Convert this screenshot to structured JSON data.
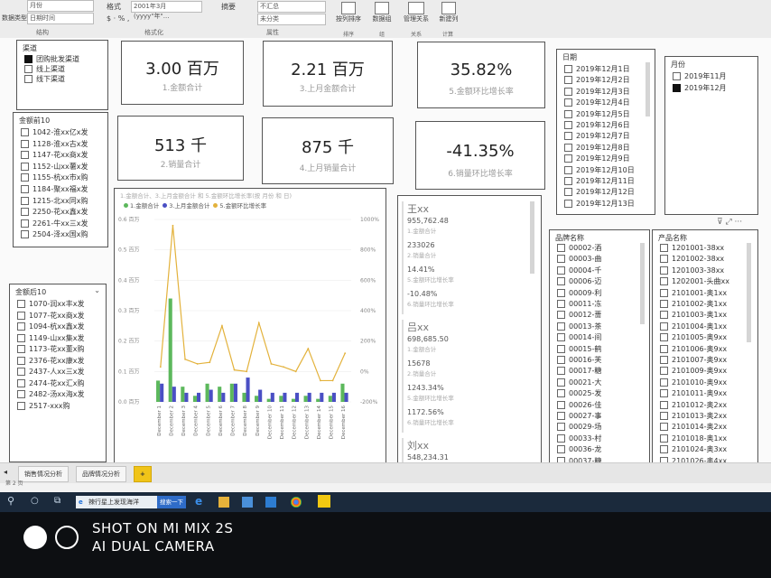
{
  "ribbon": {
    "field1_value": "月份",
    "field2_value": "日期时间",
    "format_label": "格式",
    "format_value": "2001年3月 (yyyy\"年\"...",
    "sum_label": "摘要",
    "no_sum_value": "不汇总",
    "category_value": "未分类",
    "group_format": "格式化",
    "group_properties": "属性",
    "btn_sort_by_column": "按列排序",
    "btn_data_group": "数据组",
    "btn_manage_relations": "管理关系",
    "btn_new_column": "新建列",
    "group_sort": "排序",
    "group_groups": "组",
    "group_relations": "关系",
    "group_calc": "计算",
    "left_label_1": "数据类型"
  },
  "channel_slicer": {
    "title": "渠道",
    "items": [
      {
        "label": "团购批发渠道",
        "checked": true
      },
      {
        "label": "线上渠道",
        "checked": false
      },
      {
        "label": "线下渠道",
        "checked": false
      }
    ]
  },
  "kpis": [
    {
      "value": "3.00 百万",
      "label": "1.金额合计"
    },
    {
      "value": "2.21 百万",
      "label": "3.上月金额合计"
    },
    {
      "value": "35.82%",
      "label": "5.金额环比增长率"
    },
    {
      "value": "513 千",
      "label": "2.销量合计"
    },
    {
      "value": "875 千",
      "label": "4.上月销量合计"
    },
    {
      "value": "-41.35%",
      "label": "6.销量环比增长率"
    }
  ],
  "top10_slicer": {
    "title": "金额前10",
    "items": [
      "1042-淮xx亿x发",
      "1128-淮xx古x发",
      "1147-花xx商x发",
      "1152-山xx薯x发",
      "1155-杭xx市x购",
      "1184-聚xx福x发",
      "1215-北xx同x购",
      "2250-花xx鑫x发",
      "2261-牛xx三x发",
      "2504-泽xx国x购"
    ]
  },
  "bottom10_slicer": {
    "title": "金额后10",
    "items": [
      "1070-润xx丰x发",
      "1077-花xx商x发",
      "1094-杭xx鑫x发",
      "1149-山xx集x发",
      "1173-花xx董x购",
      "2376-花xx康x发",
      "2437-人xx三x发",
      "2474-花xx汇x购",
      "2482-汤xx海x发",
      "2517-xxx购"
    ]
  },
  "chart_data": {
    "type": "bar",
    "title": "1.金额合计、3.上月金额合计 和 5.金额环比增长率(按 月份 和 日)",
    "legend": [
      "1.金额合计",
      "3.上月金额合计",
      "5.金额环比增长率"
    ],
    "categories": [
      "December 1",
      "December 2",
      "December 3",
      "December 4",
      "December 5",
      "December 6",
      "December 7",
      "December 8",
      "December 9",
      "December 10",
      "December 11",
      "December 12",
      "December 13",
      "December 14",
      "December 15",
      "December 16"
    ],
    "y_left_ticks": [
      "0.0 百万",
      "0.1 百万",
      "0.2 百万",
      "0.3 百万",
      "0.4 百万",
      "0.5 百万",
      "0.6 百万"
    ],
    "y_right_ticks": [
      "-200%",
      "0%",
      "200%",
      "400%",
      "600%",
      "800%",
      "1000%"
    ],
    "ylim_left": [
      0,
      0.6
    ],
    "ylim_right": [
      -200,
      1000
    ],
    "series": [
      {
        "name": "1.金额合计",
        "kind": "bar",
        "color": "#5cb85c",
        "values": [
          0.07,
          0.34,
          0.05,
          0.02,
          0.06,
          0.05,
          0.06,
          0.03,
          0.02,
          0.01,
          0.02,
          0.01,
          0.02,
          0.01,
          0.02,
          0.06
        ]
      },
      {
        "name": "3.上月金额合计",
        "kind": "bar",
        "color": "#4a4fc4",
        "values": [
          0.06,
          0.05,
          0.03,
          0.03,
          0.04,
          0.03,
          0.06,
          0.08,
          0.04,
          0.03,
          0.03,
          0.03,
          0.03,
          0.03,
          0.03,
          0.03
        ]
      },
      {
        "name": "5.金额环比增长率",
        "kind": "line",
        "color": "#e3b23c",
        "values": [
          30,
          960,
          80,
          50,
          60,
          300,
          10,
          0,
          320,
          50,
          30,
          0,
          150,
          -60,
          -60,
          120
        ]
      }
    ]
  },
  "names_table": {
    "blocks": [
      {
        "name": "王xx",
        "rows": [
          {
            "v": "955,762.48",
            "l": "1.金额合计"
          },
          {
            "v": "233026",
            "l": "2.销量合计"
          },
          {
            "v": "14.41%",
            "l": "5.金额环比增长率"
          },
          {
            "v": "-10.48%",
            "l": "6.销量环比增长率"
          }
        ]
      },
      {
        "name": "吕xx",
        "rows": [
          {
            "v": "698,685.50",
            "l": "1.金额合计"
          },
          {
            "v": "15678",
            "l": "2.销量合计"
          },
          {
            "v": "1243.34%",
            "l": "5.金额环比增长率"
          },
          {
            "v": "1172.56%",
            "l": "6.销量环比增长率"
          }
        ]
      },
      {
        "name": "刘xx",
        "rows": [
          {
            "v": "548,234.31",
            "l": "1.金额合计"
          }
        ]
      }
    ]
  },
  "date_slicer": {
    "title": "日期",
    "items": [
      "2019年12月1日",
      "2019年12月2日",
      "2019年12月3日",
      "2019年12月4日",
      "2019年12月5日",
      "2019年12月6日",
      "2019年12月7日",
      "2019年12月8日",
      "2019年12月9日",
      "2019年12月10日",
      "2019年12月11日",
      "2019年12月12日",
      "2019年12月13日"
    ]
  },
  "month_slicer": {
    "title": "月份",
    "items": [
      {
        "label": "2019年11月",
        "checked": false
      },
      {
        "label": "2019年12月",
        "checked": true
      }
    ]
  },
  "product_name_slicer": {
    "title": "品牌名称",
    "items": [
      "00002-酒",
      "00003-曲",
      "00004-千",
      "00006-迈",
      "00009-利",
      "00011-冻",
      "00012-蔷",
      "00013-茶",
      "00014-间",
      "00015-鹤",
      "00016-芙",
      "00017-糖",
      "00021-大",
      "00025-发",
      "00026-佳",
      "00027-事",
      "00029-场",
      "00033-村",
      "00036-龙",
      "00037-糖"
    ]
  },
  "product_slicer": {
    "title": "产品名称",
    "items": [
      "1201001-38xx",
      "1201002-38xx",
      "1201003-38xx",
      "1202001-头曲xx",
      "2101001-奥1xx",
      "2101002-奥1xx",
      "2101003-奥1xx",
      "2101004-奥1xx",
      "2101005-奥9xx",
      "2101006-奥9xx",
      "2101007-奥9xx",
      "2101009-奥9xx",
      "2101010-奥9xx",
      "2101011-奥9xx",
      "2101012-奥2xx",
      "2101013-奥2xx",
      "2101014-奥2xx",
      "2101018-奥1xx",
      "2101024-奥3xx",
      "2101026-奥4xx"
    ]
  },
  "page_tabs": [
    "销售情况分析",
    "品牌情况分析"
  ],
  "add_tab": "+",
  "page_indicator": "第 2 页",
  "taskbar": {
    "search_text": "辣行星上发现海洋",
    "search_button": "搜索一下"
  },
  "watermark": {
    "line1": "SHOT ON MI MIX 2S",
    "line2": "AI DUAL CAMERA"
  }
}
